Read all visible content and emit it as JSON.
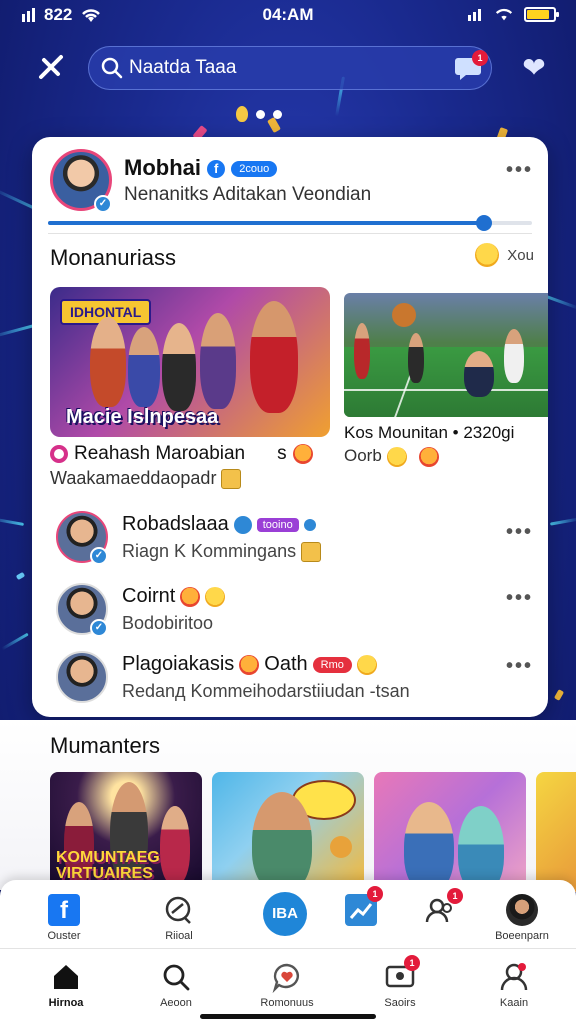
{
  "status_bar": {
    "left_time": "822",
    "center_time": "04:AM",
    "battery_level": 0.85
  },
  "header": {
    "search_value": "Naatda Taaa",
    "msg_badge": "1"
  },
  "profile": {
    "name": "Mobhai",
    "tag": "2couo",
    "subtitle": "Nenanitks Aditakan Veondian",
    "progress": 0.9
  },
  "section1": {
    "title": "Monanuriass",
    "right_text": "Xou",
    "feed_left": {
      "banner": "IDHONTAL",
      "caption": "Macie Islnpesaa",
      "title": "Reahash Maroabian",
      "title_suffix": "s",
      "subtitle": "Waakamaeddaopadr"
    },
    "feed_right": {
      "title": "Kos Mounitan • 2320gi",
      "subtitle": "Oorb"
    }
  },
  "rows": [
    {
      "title": "Robadslaaa",
      "pill": "tooino",
      "subtitle": "Riagn K Kommingans"
    },
    {
      "title": "Coirnt",
      "subtitle": "Bodobiritoo"
    },
    {
      "title": "Plagoiakasis",
      "title2": "Oath",
      "pill": "Rmo",
      "subtitle": "Redanд Kommeihodarstiiudan -tsan"
    }
  ],
  "section2": {
    "title": "Mumanters",
    "thumb1_caption": "KOMUNTAEG VIRTUAIRES"
  },
  "tabbar_top": [
    {
      "label": "Ouster",
      "icon": "facebook-icon"
    },
    {
      "label": "Riioal",
      "icon": "search-chat-icon"
    },
    {
      "label": "IBA",
      "icon": "center-button"
    },
    {
      "label": "",
      "icon": "chart-icon",
      "badge": "1"
    },
    {
      "label": "",
      "icon": "friends-icon",
      "badge": "1"
    },
    {
      "label": "Boeenparn",
      "icon": "profile-avatar"
    }
  ],
  "tabbar_bottom": [
    {
      "label": "Hirnoa",
      "icon": "home-icon"
    },
    {
      "label": "Aeoon",
      "icon": "search-icon"
    },
    {
      "label": "Romonuus",
      "icon": "chat-heart-icon"
    },
    {
      "label": "Saoirs",
      "icon": "tv-icon",
      "badge": "1"
    },
    {
      "label": "Kaain",
      "icon": "user-icon"
    }
  ]
}
